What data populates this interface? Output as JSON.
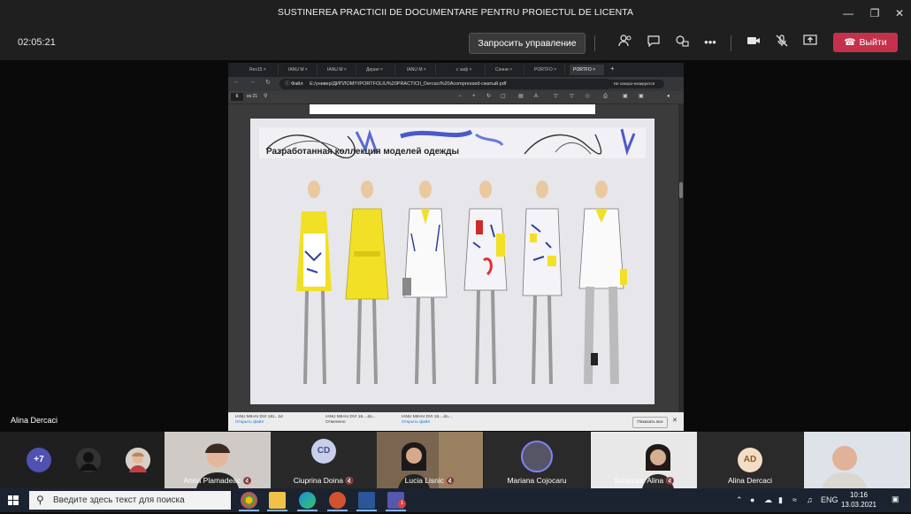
{
  "window": {
    "title": "SUSTINEREA PRACTICII DE DOCUMENTARE PENTRU PROIECTUL DE LICENTA"
  },
  "toolbar": {
    "timer": "02:05:21",
    "request_control_label": "Запросить управление",
    "leave_label": "Выйти",
    "leave_color": "#c4314b"
  },
  "presenter": {
    "name": "Alina Dercaci"
  },
  "browser": {
    "tabs": [
      "Rev15 ×",
      "IANU M ×",
      "IANU M ×",
      "Дерил ×",
      "IANU M ×",
      "с заф ×",
      "Сонни ×",
      "PORTFO ×",
      "PORTFO ×"
    ],
    "file_label": "Файл",
    "url": "E:/универ/ДИПЛОМ!!!/PORTFOLIU%20PRACTICII_Dercaci%20Acompressed-сжатый.pdf",
    "sync_label": "Не синхро-низируется",
    "page_number": "6",
    "page_of": "из 21"
  },
  "pdf": {
    "page_title": "Разработанная коллекция моделей одежды"
  },
  "downloads": {
    "items": [
      {
        "name": "IANU MIHAI DVI 161...txt",
        "action": "Открыть файл"
      },
      {
        "name": "IANU MIHAI DVI 16....do...",
        "action": "Отменено"
      },
      {
        "name": "IANU MIHAI DVI 16....do...",
        "action": "Открыть файл"
      }
    ],
    "show_all_label": "Показать все"
  },
  "participants": {
    "more_count": "+7",
    "tiles": [
      {
        "name": "Anna Plamadeac"
      },
      {
        "name": "Ciuprina Doina",
        "initials": "CD"
      },
      {
        "name": "Lucia Lisnic"
      },
      {
        "name": "Mariana Cojocaru"
      },
      {
        "name": "Tocarciuc Alina"
      },
      {
        "name": "Alina Dercaci",
        "initials": "AD"
      },
      {
        "name": ""
      }
    ]
  },
  "taskbar": {
    "search_placeholder": "Введите здесь текст для поиска",
    "lang": "ENG",
    "time": "10:16",
    "date": "13.03.2021",
    "notification_count": "1"
  }
}
